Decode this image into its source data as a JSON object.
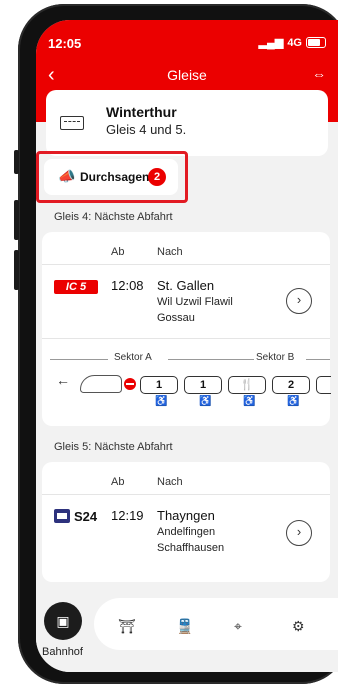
{
  "status_bar": {
    "time": "12:05",
    "network": "4G"
  },
  "nav": {
    "back": "‹",
    "title": "Gleise",
    "sbb_logo": "⇔"
  },
  "station": {
    "name": "Winterthur",
    "platforms": "Gleis 4 und 5."
  },
  "announcements": {
    "label": "Durchsagen",
    "count": "2"
  },
  "platform4": {
    "heading": "Gleis 4: Nächste Abfahrt",
    "col_ab": "Ab",
    "col_nach": "Nach",
    "train": "IC 5",
    "time": "12:08",
    "destination": "St. Gallen",
    "via_line1": "Wil  Uzwil  Flawil",
    "via_line2": "Gossau",
    "sektor_a": "Sektor A",
    "sektor_b": "Sektor B",
    "wagons": [
      "1",
      "1",
      "🍴",
      "2"
    ]
  },
  "platform5": {
    "heading": "Gleis 5: Nächste Abfahrt",
    "col_ab": "Ab",
    "col_nach": "Nach",
    "train": "S24",
    "time": "12:19",
    "destination": "Thayngen",
    "via_line1": "Andelfingen",
    "via_line2": "Schaffhausen"
  },
  "tabbar": {
    "active_label": "Bahnhof"
  },
  "colors": {
    "sbb_red": "#eb0000",
    "s_bahn_blue": "#2d327d"
  }
}
